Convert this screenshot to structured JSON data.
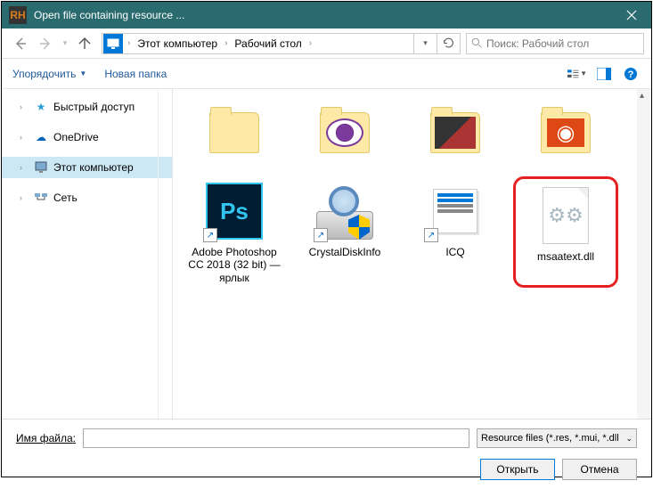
{
  "titlebar": {
    "logo_text": "RH",
    "title": "Open file containing resource ..."
  },
  "breadcrumb": {
    "items": [
      "Этот компьютер",
      "Рабочий стол"
    ]
  },
  "search": {
    "placeholder": "Поиск: Рабочий стол"
  },
  "toolbar": {
    "organize": "Упорядочить",
    "new_folder": "Новая папка"
  },
  "sidebar": {
    "quick_access": "Быстрый доступ",
    "onedrive": "OneDrive",
    "this_pc": "Этот компьютер",
    "network": "Сеть"
  },
  "files": {
    "row1": [
      "",
      "",
      "",
      ""
    ],
    "ps": "Adobe Photoshop CC 2018 (32 bit) — ярлык",
    "cdi": "CrystalDiskInfo",
    "icq": "ICQ",
    "dll": "msaatext.dll"
  },
  "footer": {
    "filename_label": "Имя файла:",
    "filename_value": "",
    "filter": "Resource files (*.res, *.mui, *.dll",
    "open": "Открыть",
    "cancel": "Отмена"
  }
}
